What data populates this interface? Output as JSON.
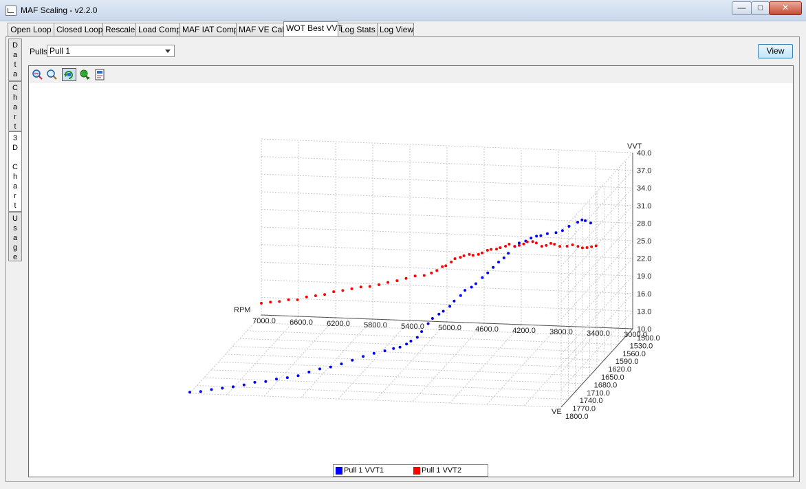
{
  "window": {
    "title": "MAF Scaling - v2.2.0",
    "minimize": "—",
    "maximize": "□",
    "close": "✕"
  },
  "tabs": [
    "Open Loop",
    "Closed Loop",
    "Rescale",
    "Load Comp",
    "MAF IAT Comp",
    "MAF VE Calc",
    "WOT Best VVT",
    "Log Stats",
    "Log View"
  ],
  "active_tab": "WOT Best VVT",
  "side_tabs": [
    "Data",
    "Chart",
    "3D Chart",
    "Usage"
  ],
  "active_side_tab": "3D Chart",
  "pulls": {
    "label": "Pulls",
    "selected": "Pull 1"
  },
  "view_button": "View",
  "toolbar_icons": [
    "zoom-in-out-icon",
    "zoom-icon",
    "rotate-icon",
    "pan-icon",
    "export-icon"
  ],
  "chart_data": {
    "type": "scatter",
    "dimensions": "3d",
    "axes": {
      "x": {
        "label": "RPM",
        "ticks": [
          "7000.0",
          "6600.0",
          "6200.0",
          "5800.0",
          "5400.0",
          "5000.0",
          "4600.0",
          "4200.0",
          "3800.0",
          "3400.0",
          "3000.0"
        ],
        "range": [
          3000,
          7000
        ]
      },
      "y": {
        "label": "VE",
        "ticks": [
          "1500.0",
          "1530.0",
          "1560.0",
          "1590.0",
          "1620.0",
          "1650.0",
          "1680.0",
          "1710.0",
          "1740.0",
          "1770.0",
          "1800.0"
        ],
        "range": [
          1500,
          1800
        ]
      },
      "z": {
        "label": "VVT",
        "ticks": [
          "10.0",
          "13.0",
          "16.0",
          "19.0",
          "22.0",
          "25.0",
          "28.0",
          "31.0",
          "34.0",
          "37.0",
          "40.0"
        ],
        "range": [
          10,
          40
        ]
      }
    },
    "grid": true,
    "legend_position": "bottom-center",
    "series": [
      {
        "name": "Pull 1 VVT1",
        "color": "#0000ff",
        "points": [
          [
            3300,
            30.5
          ],
          [
            3350,
            31
          ],
          [
            3380,
            31.2
          ],
          [
            3420,
            30.9
          ],
          [
            3500,
            30.4
          ],
          [
            3560,
            29.8
          ],
          [
            3620,
            29.6
          ],
          [
            3700,
            29.6
          ],
          [
            3760,
            29.4
          ],
          [
            3800,
            29.4
          ],
          [
            3850,
            29.2
          ],
          [
            3900,
            28.8
          ],
          [
            3960,
            28.6
          ],
          [
            4000,
            28.1
          ],
          [
            4060,
            27.1
          ],
          [
            4100,
            26.4
          ],
          [
            4150,
            25.8
          ],
          [
            4200,
            25
          ],
          [
            4250,
            24.2
          ],
          [
            4300,
            23.5
          ],
          [
            4360,
            22.6
          ],
          [
            4400,
            22.1
          ],
          [
            4460,
            21.7
          ],
          [
            4500,
            20.9
          ],
          [
            4560,
            20.1
          ],
          [
            4600,
            19.3
          ],
          [
            4660,
            18.6
          ],
          [
            4700,
            18.2
          ],
          [
            4760,
            17.6
          ],
          [
            4800,
            16.8
          ],
          [
            4860,
            15.6
          ],
          [
            4900,
            14.7
          ],
          [
            4960,
            14.2
          ],
          [
            5000,
            13.8
          ],
          [
            5060,
            13.4
          ],
          [
            5120,
            13.3
          ],
          [
            5200,
            13.1
          ],
          [
            5300,
            12.9
          ],
          [
            5400,
            12.6
          ],
          [
            5500,
            12.2
          ],
          [
            5600,
            11.8
          ],
          [
            5700,
            11.5
          ],
          [
            5800,
            11.4
          ],
          [
            5900,
            11.1
          ],
          [
            6000,
            10.7
          ],
          [
            6100,
            10.6
          ],
          [
            6200,
            10.6
          ],
          [
            6300,
            10.4
          ],
          [
            6400,
            10.5
          ],
          [
            6500,
            10.3
          ],
          [
            6600,
            10.2
          ],
          [
            6700,
            10.2
          ],
          [
            6800,
            10.2
          ],
          [
            6900,
            10.1
          ],
          [
            7000,
            10.2
          ]
        ]
      },
      {
        "name": "Pull 1 VVT2",
        "color": "#ff0000",
        "points": [
          [
            3300,
            25.6
          ],
          [
            3350,
            25.4
          ],
          [
            3400,
            25.2
          ],
          [
            3450,
            25.1
          ],
          [
            3500,
            25.3
          ],
          [
            3560,
            25.5
          ],
          [
            3620,
            25.2
          ],
          [
            3700,
            25.1
          ],
          [
            3760,
            25.4
          ],
          [
            3800,
            25.5
          ],
          [
            3850,
            25.1
          ],
          [
            3900,
            24.9
          ],
          [
            3960,
            25.4
          ],
          [
            4000,
            25.6
          ],
          [
            4060,
            25.5
          ],
          [
            4100,
            25.1
          ],
          [
            4150,
            24.8
          ],
          [
            4200,
            24.6
          ],
          [
            4260,
            24.9
          ],
          [
            4300,
            24.5
          ],
          [
            4360,
            24.2
          ],
          [
            4400,
            23.9
          ],
          [
            4460,
            23.8
          ],
          [
            4500,
            23.6
          ],
          [
            4560,
            23.1
          ],
          [
            4600,
            22.8
          ],
          [
            4660,
            22.6
          ],
          [
            4700,
            22.7
          ],
          [
            4760,
            22.4
          ],
          [
            4800,
            22.1
          ],
          [
            4860,
            21.8
          ],
          [
            4900,
            21.2
          ],
          [
            4960,
            20.5
          ],
          [
            5000,
            20.3
          ],
          [
            5060,
            19.6
          ],
          [
            5120,
            19.1
          ],
          [
            5200,
            18.6
          ],
          [
            5300,
            18.4
          ],
          [
            5400,
            17.9
          ],
          [
            5500,
            17.4
          ],
          [
            5600,
            17.0
          ],
          [
            5700,
            16.5
          ],
          [
            5800,
            16.1
          ],
          [
            5900,
            15.9
          ],
          [
            6000,
            15.5
          ],
          [
            6100,
            15.1
          ],
          [
            6200,
            14.8
          ],
          [
            6300,
            14.2
          ],
          [
            6400,
            13.9
          ],
          [
            6500,
            13.6
          ],
          [
            6600,
            13.0
          ],
          [
            6700,
            12.9
          ],
          [
            6800,
            12.5
          ],
          [
            6900,
            12.3
          ],
          [
            7000,
            12.0
          ]
        ]
      }
    ]
  }
}
